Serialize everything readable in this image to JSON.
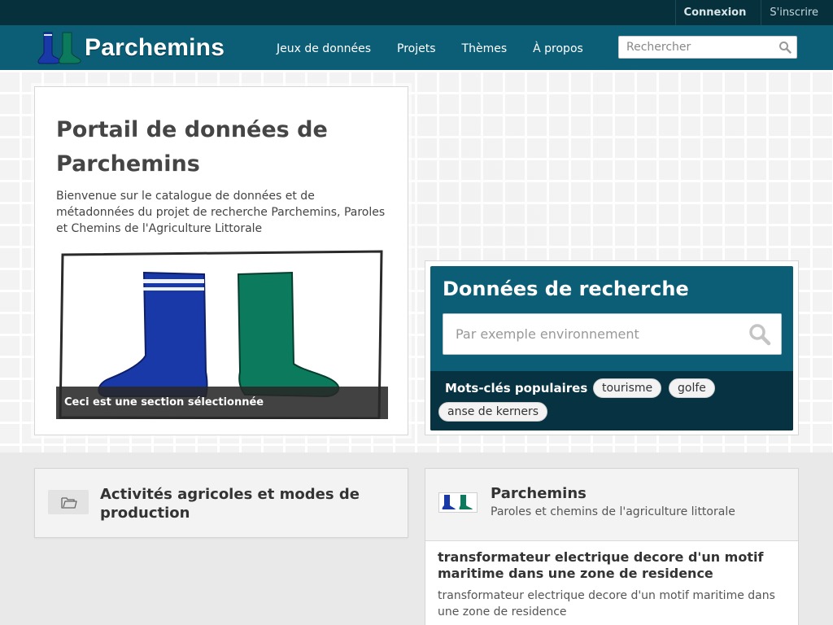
{
  "account": {
    "login_label": "Connexion",
    "register_label": "S'inscrire"
  },
  "brand": {
    "name": "Parchemins"
  },
  "nav": {
    "items": [
      {
        "label": "Jeux de données"
      },
      {
        "label": "Projets"
      },
      {
        "label": "Thèmes"
      },
      {
        "label": "À propos"
      }
    ]
  },
  "header_search": {
    "placeholder": "Rechercher"
  },
  "welcome": {
    "title": "Portail de données de Parchemins",
    "text": "Bienvenue sur le catalogue de données et de métadonnées du projet de recherche Parchemins, Paroles et Chemins de l'Agriculture Littorale",
    "featured_caption": "Ceci est une section sélectionnée"
  },
  "research": {
    "title": "Données de recherche",
    "placeholder": "Par exemple environnement",
    "tags_title": "Mots-clés populaires",
    "tags": [
      "tourisme",
      "golfe",
      "anse de kerners"
    ]
  },
  "group": {
    "title": "Activités agricoles et modes de production"
  },
  "organization": {
    "name": "Parchemins",
    "description": "Paroles et chemins de l'agriculture littorale",
    "item_title": "transformateur electrique decore d'un motif maritime dans une zone de residence",
    "item_description": "transformateur electrique decore d'un motif maritime dans une zone de residence"
  },
  "colors": {
    "accent": "#0c5e77",
    "account_bar": "#06303c",
    "tags_band": "#063242",
    "boot_blue": "#1a39a8",
    "boot_green": "#0c7a5c"
  }
}
